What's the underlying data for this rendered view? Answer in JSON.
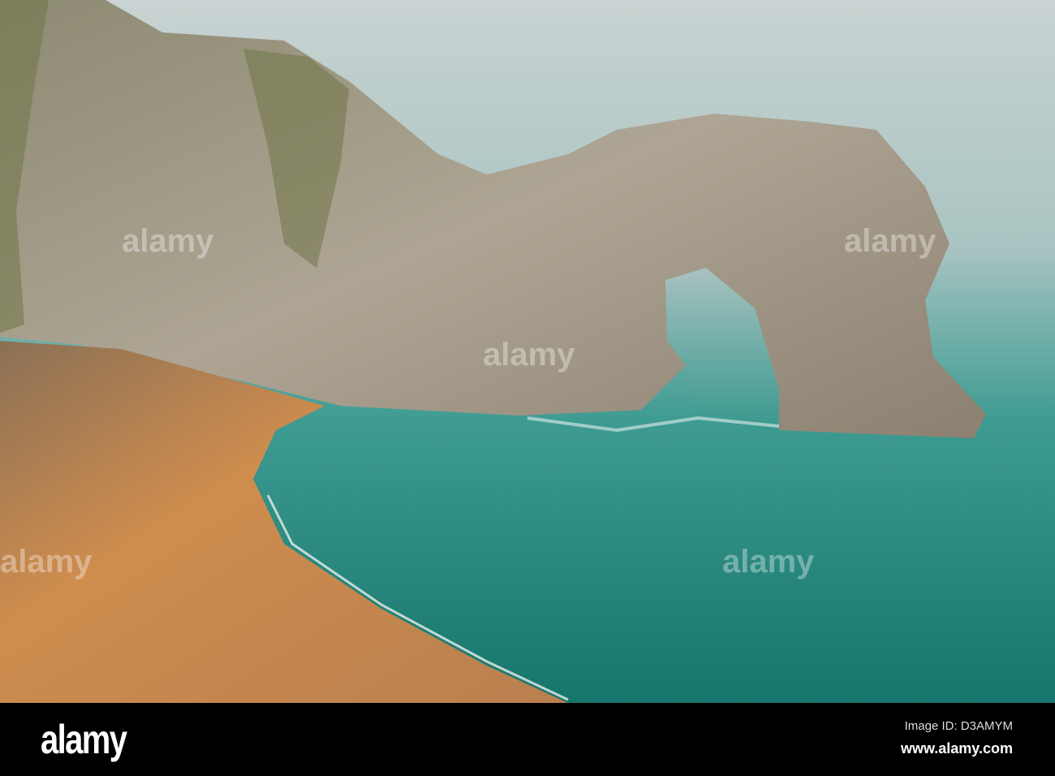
{
  "photo": {
    "subject": "sea-arch-cove"
  },
  "watermark": {
    "text": "alamy"
  },
  "footer": {
    "logo": "alamy",
    "image_id": "Image ID: D3AMYM",
    "url": "www.alamy.com"
  },
  "colors": {
    "sea_far": "#c7d2d2",
    "sea_near": "#1e8077",
    "rock": "#a8a190",
    "sand": "#c8864a"
  }
}
